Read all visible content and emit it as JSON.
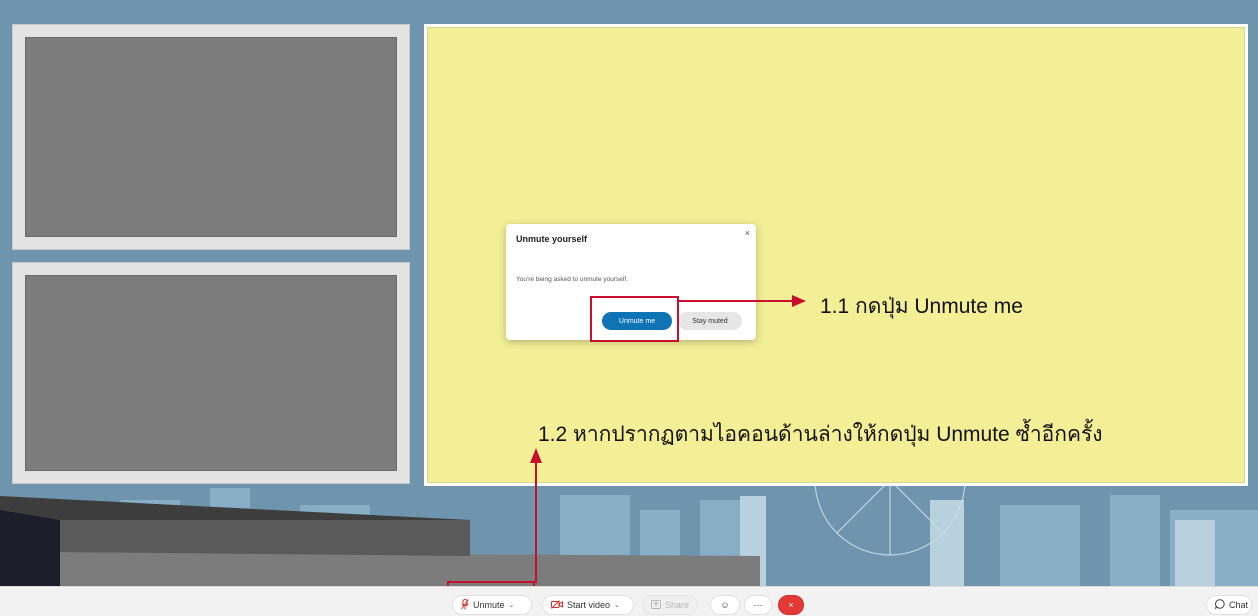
{
  "dialog": {
    "title": "Unmute yourself",
    "close_icon": "×",
    "message": "You're being asked to unmute yourself.",
    "primary_button": "Unmute me",
    "secondary_button": "Stay muted"
  },
  "annotations": {
    "step_1_1": "1.1 กดปุ่ม Unmute me",
    "step_1_2": "1.2 หากปรากฏตามไอคอนด้านล่างให้กดปุ่ม Unmute ซ้ำอีกครั้ง",
    "highlight_color": "#c8102e"
  },
  "toolbar": {
    "unmute": {
      "label": "Unmute",
      "icon": "muted-mic-icon",
      "caret": "⌄"
    },
    "video": {
      "label": "Start video",
      "icon": "video-off-icon",
      "caret": "⌄"
    },
    "share": {
      "label": "Share",
      "icon": "share-icon"
    },
    "reactions": {
      "icon": "emoji-icon",
      "glyph": "☺"
    },
    "more": {
      "icon": "more-icon",
      "glyph": "···"
    },
    "end": {
      "icon": "end-call-icon",
      "glyph": "×"
    },
    "chat": {
      "label": "Chat",
      "icon": "chat-icon"
    }
  },
  "colors": {
    "share_background": "#f3ef96",
    "primary_blue": "#0e74b5",
    "end_red": "#e53935"
  }
}
